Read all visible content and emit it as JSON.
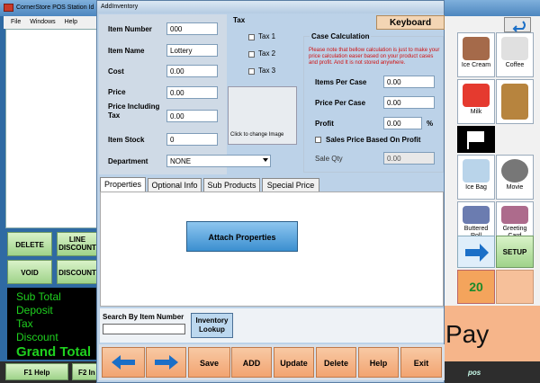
{
  "background_app": {
    "title": "CornerStore POS Station Id",
    "menu": [
      "File",
      "Windows",
      "Help"
    ],
    "buttons": {
      "delete": "DELETE",
      "line_discount": "LINE DISCOUNT",
      "void": "VOID",
      "discount": "DISCOUNT",
      "setup": "SETUP",
      "quick_amount": "20",
      "pay": "Pay",
      "f1_help": "F1 Help",
      "f2": "F2 In"
    },
    "totals": [
      "Sub Total",
      "Deposit",
      "Tax",
      "Discount"
    ],
    "grand_total": "Grand Total",
    "brand": "pos",
    "products": [
      {
        "label": "Ice Cream",
        "icon": "ice-cream-icon",
        "color": "#a56a4a"
      },
      {
        "label": "Coffee",
        "icon": "coffee-icon",
        "color": "#e0e0e0"
      },
      {
        "label": "Milk",
        "icon": "milk-icon",
        "color": "#e53a2f"
      },
      {
        "label": "",
        "icon": "cookies-icon",
        "color": "#b7843e"
      },
      {
        "label": "Ice Bag",
        "icon": "ice-bag-icon",
        "color": "#b9d4ea"
      },
      {
        "label": "Movie",
        "icon": "dvd-icon",
        "color": "#777"
      },
      {
        "label": "Buttered Roll",
        "icon": "roll-icon",
        "color": "#6b7cb0"
      },
      {
        "label": "Greeting Card",
        "icon": "card-icon",
        "color": "#ad6b8c"
      }
    ]
  },
  "dialog": {
    "title": "AddInventory",
    "keyboard": "Keyboard",
    "fields": {
      "item_number": {
        "label": "Item Number",
        "value": "000"
      },
      "item_name": {
        "label": "Item Name",
        "value": "Lottery"
      },
      "cost": {
        "label": "Cost",
        "value": "0.00"
      },
      "price": {
        "label": "Price",
        "value": "0.00"
      },
      "price_incl_tax": {
        "label": "Price Including Tax",
        "value": "0.00"
      },
      "item_stock": {
        "label": "Item Stock",
        "value": "0"
      },
      "department": {
        "label": "Department",
        "value": "NONE"
      }
    },
    "tax": {
      "title": "Tax",
      "items": [
        "Tax 1",
        "Tax 2",
        "Tax 3"
      ]
    },
    "image_hint": "Click to change Image",
    "case": {
      "title": "Case Calculation",
      "note": "Please note that bellow calculation is just to make your price calculation easer based on your product cases and profit. And It is not stored anywhere.",
      "items_per_case": {
        "label": "Items Per Case",
        "value": "0.00"
      },
      "price_per_case": {
        "label": "Price Per Case",
        "value": "0.00"
      },
      "profit": {
        "label": "Profit",
        "value": "0.00",
        "unit": "%"
      },
      "sales_price_based": "Sales Price Based On Profit",
      "sale_qty": {
        "label": "Sale Qty",
        "value": "0.00"
      }
    },
    "tabs": [
      "Properties",
      "Optional Info",
      "Sub Products",
      "Special Price"
    ],
    "attach_properties": "Attach Properties",
    "search": {
      "label": "Search By Item Number",
      "value": ""
    },
    "inventory_lookup": "Inventory Lookup",
    "actions": {
      "save": "Save",
      "add": "ADD",
      "update": "Update",
      "delete": "Delete",
      "help": "Help",
      "exit": "Exit"
    }
  }
}
